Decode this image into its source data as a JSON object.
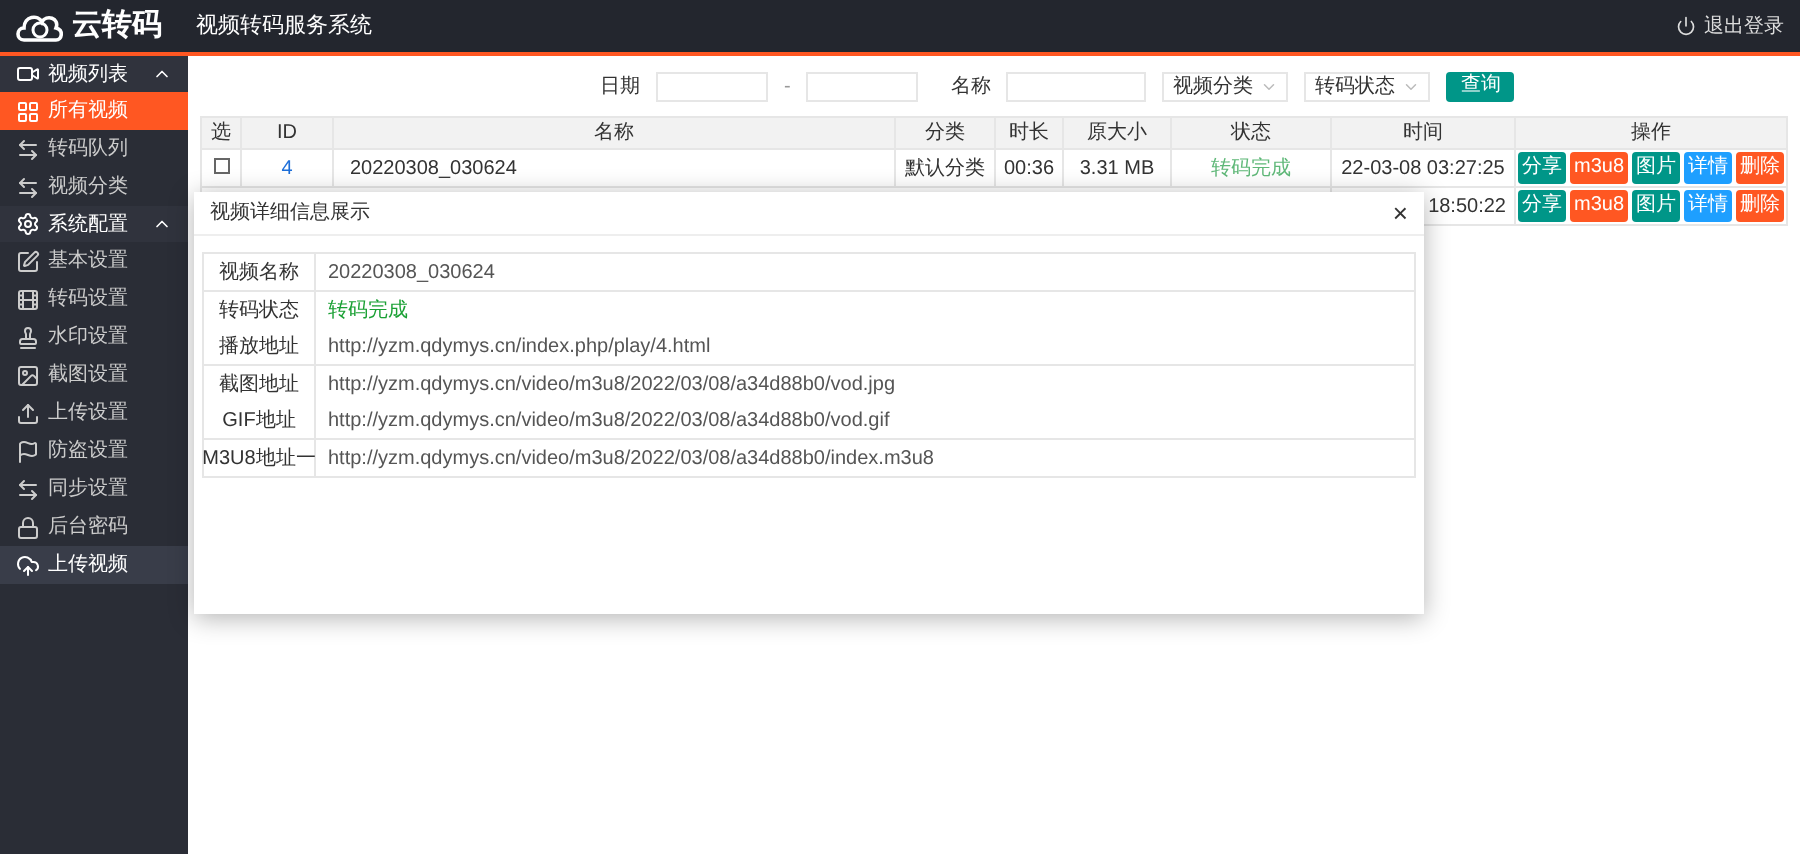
{
  "header": {
    "logo": "云转码",
    "title": "视频转码服务系统",
    "logout": "退出登录"
  },
  "sidebar": {
    "groups": [
      {
        "label": "视频列表",
        "expanded": true,
        "items": [
          {
            "label": "所有视频",
            "selected": true
          },
          {
            "label": "转码队列",
            "selected": false
          },
          {
            "label": "视频分类",
            "selected": false
          }
        ]
      },
      {
        "label": "系统配置",
        "expanded": true,
        "items": [
          {
            "label": "基本设置",
            "selected": false
          },
          {
            "label": "转码设置",
            "selected": false
          },
          {
            "label": "水印设置",
            "selected": false
          },
          {
            "label": "截图设置",
            "selected": false
          },
          {
            "label": "上传设置",
            "selected": false
          },
          {
            "label": "防盗设置",
            "selected": false
          },
          {
            "label": "同步设置",
            "selected": false
          },
          {
            "label": "后台密码",
            "selected": false
          }
        ]
      }
    ],
    "footer": {
      "label": "上传视频"
    }
  },
  "search": {
    "date_label": "日期",
    "separator": "-",
    "name_label": "名称",
    "category_select": "视频分类",
    "status_select": "转码状态",
    "submit": "查询"
  },
  "table": {
    "columns": [
      "选",
      "ID",
      "名称",
      "分类",
      "时长",
      "原大小",
      "状态",
      "时间",
      "操作"
    ],
    "rows": [
      {
        "checked": false,
        "id": "4",
        "name": "20220308_030624",
        "category": "默认分类",
        "duration": "00:36",
        "size": "3.31 MB",
        "status": "转码完成",
        "time": "22-03-08 03:27:25",
        "actions": [
          {
            "label": "分享",
            "kind": "teal"
          },
          {
            "label": "m3u8",
            "kind": "orange"
          },
          {
            "label": "图片",
            "kind": "teal"
          },
          {
            "label": "详情",
            "kind": "blue"
          },
          {
            "label": "删除",
            "kind": "orange"
          }
        ]
      },
      {
        "time": "18:50:22",
        "actions": [
          {
            "label": "分享",
            "kind": "teal"
          },
          {
            "label": "m3u8",
            "kind": "orange"
          },
          {
            "label": "图片",
            "kind": "teal"
          },
          {
            "label": "详情",
            "kind": "blue"
          },
          {
            "label": "删除",
            "kind": "orange"
          }
        ]
      }
    ]
  },
  "modal": {
    "title": "视频详细信息展示",
    "close": "×",
    "groups": [
      [
        {
          "label": "视频名称",
          "value": "20220308_030624",
          "kind": "text"
        }
      ],
      [
        {
          "label": "转码状态",
          "value": "转码完成",
          "kind": "status"
        },
        {
          "label": "播放地址",
          "value": "http://yzm.qdymys.cn/index.php/play/4.html",
          "kind": "text"
        }
      ],
      [
        {
          "label": "截图地址",
          "value": "http://yzm.qdymys.cn/video/m3u8/2022/03/08/a34d88b0/vod.jpg",
          "kind": "text"
        },
        {
          "label": "GIF地址",
          "value": "http://yzm.qdymys.cn/video/m3u8/2022/03/08/a34d88b0/vod.gif",
          "kind": "text"
        }
      ],
      [
        {
          "label": "M3U8地址一",
          "value": "http://yzm.qdymys.cn/video/m3u8/2022/03/08/a34d88b0/index.m3u8",
          "kind": "text"
        }
      ]
    ]
  }
}
